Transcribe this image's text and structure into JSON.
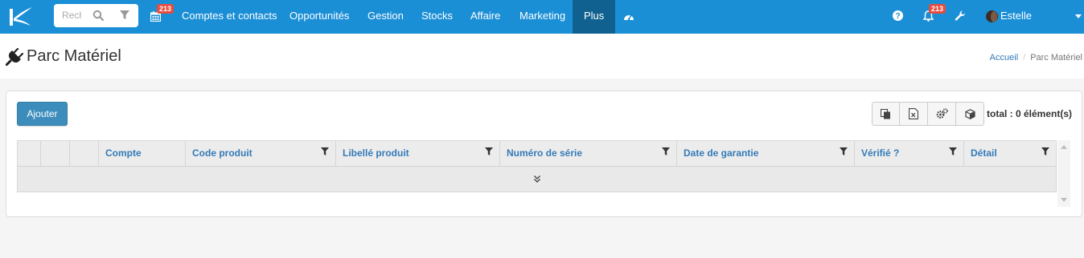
{
  "navbar": {
    "search_placeholder": "Rechercher",
    "calendar_badge": "213",
    "items": [
      {
        "label": "Comptes et contacts"
      },
      {
        "label": "Opportunités"
      },
      {
        "label": "Gestion"
      },
      {
        "label": "Stocks"
      },
      {
        "label": "Affaire"
      },
      {
        "label": "Marketing"
      },
      {
        "label": "Plus"
      }
    ],
    "notifications_badge": "213",
    "user_name": "Estelle SORHAITZ"
  },
  "header": {
    "title": "Parc Matériel",
    "breadcrumb": [
      "Accueil",
      "Parc Matériel"
    ]
  },
  "toolbar": {
    "add_label": "Ajouter",
    "total_label": "total : 0 élément(s)"
  },
  "table": {
    "columns": [
      {
        "label": ""
      },
      {
        "label": ""
      },
      {
        "label": ""
      },
      {
        "label": "Compte"
      },
      {
        "label": "Code produit"
      },
      {
        "label": "Libellé produit"
      },
      {
        "label": "Numéro de série"
      },
      {
        "label": "Date de garantie"
      },
      {
        "label": "Vérifié ?"
      },
      {
        "label": "Détail"
      }
    ]
  },
  "colors": {
    "navbar": "#1b8fd6",
    "navbar_active": "#10618f",
    "primary_button": "#3c8dbc",
    "badge": "#e74c3c",
    "link": "#337ab7"
  }
}
